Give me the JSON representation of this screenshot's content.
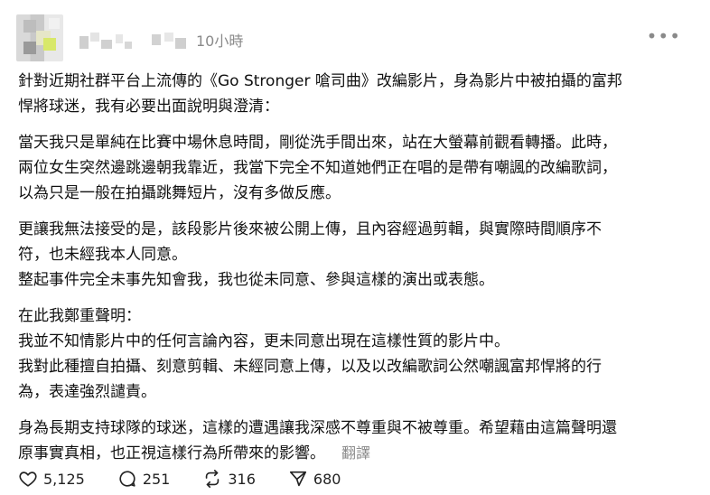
{
  "post": {
    "timestamp": "10小時",
    "more_icon": "more-horizontal-icon",
    "paragraphs": [
      {
        "lines": [
          "針對近期社群平台上流傳的《Go Stronger 嗆司曲》改編影片，身為影片中被拍攝的富邦",
          "悍將球迷，我有必要出面說明與澄清："
        ]
      },
      {
        "lines": [
          "當天我只是單純在比賽中場休息時間，剛從洗手間出來，站在大螢幕前觀看轉播。此時，",
          "兩位女生突然邊跳邊朝我靠近，我當下完全不知道她們正在唱的是帶有嘲諷的改編歌詞，",
          "以為只是一般在拍攝跳舞短片，沒有多做反應。"
        ]
      },
      {
        "lines": [
          "更讓我無法接受的是，該段影片後來被公開上傳，且內容經過剪輯，與實際時間順序不",
          "符，也未經我本人同意。",
          "整起事件完全未事先知會我，我也從未同意、參與這樣的演出或表態。"
        ]
      },
      {
        "lines": [
          "在此我鄭重聲明：",
          "我並不知情影片中的任何言論內容，更未同意出現在這樣性質的影片中。",
          "我對此種擅自拍攝、刻意剪輯、未經同意上傳，以及以改編歌詞公然嘲諷富邦悍將的行",
          "為，表達強烈譴責。"
        ]
      },
      {
        "lines": [
          "身為長期支持球隊的球迷，這樣的遭遇讓我深感不尊重與不被尊重。希望藉由這篇聲明還",
          "原事實真相，也正視這樣行為所帶來的影響。"
        ]
      }
    ],
    "translate_label": "翻譯"
  },
  "actions": {
    "likes": "5,125",
    "comments": "251",
    "reposts": "316",
    "shares": "680"
  },
  "icons": {
    "like": "heart-icon",
    "comment": "comment-bubble-icon",
    "repost": "repost-icon",
    "share": "send-icon"
  },
  "colors": {
    "text": "#111111",
    "muted": "#8a8a8a"
  }
}
